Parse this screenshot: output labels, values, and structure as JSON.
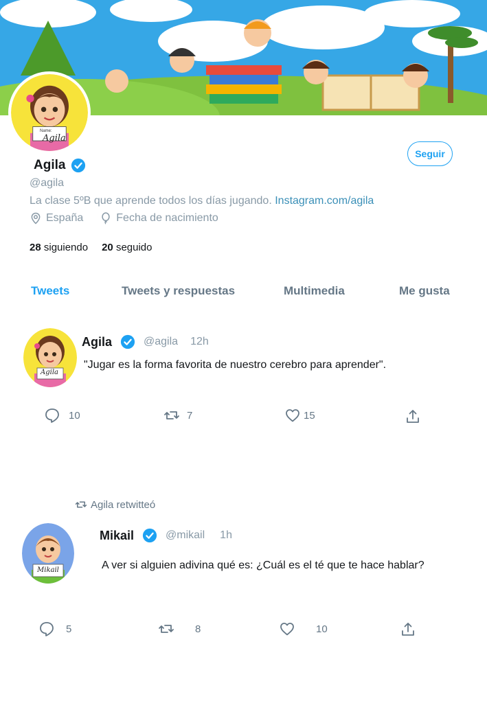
{
  "profile": {
    "name": "Agila",
    "handle": "@agila",
    "bio_text": "La clase 5ºB  que aprende todos los días jugando. ",
    "bio_link": "Instagram.com/agila",
    "location": "España",
    "birthday": "Fecha de nacimiento",
    "following_count": "28",
    "following_label": "siguiendo",
    "followers_count": "20",
    "followers_label": "seguido",
    "follow_button": "Seguir",
    "avatar_tag": "Agila",
    "avatar_name_prefix": "Name:"
  },
  "tabs": [
    {
      "label": "Tweets",
      "active": true
    },
    {
      "label": "Tweets y respuestas",
      "active": false
    },
    {
      "label": "Multimedia",
      "active": false
    },
    {
      "label": "Me gusta",
      "active": false
    }
  ],
  "tweets": [
    {
      "name": "Agila",
      "handle": "@agila",
      "time": "12h",
      "text": "\"Jugar es la forma favorita de nuestro cerebro para aprender\".",
      "avatar_tag": "Agila",
      "replies": "10",
      "retweets": "7",
      "likes": "15"
    },
    {
      "retweet_label": "Agila retwitteó",
      "name": "Mikail",
      "handle": "@mikail",
      "time": "1h",
      "text": "A ver si alguien adivina qué es: ¿Cuál es el té que te hace hablar?",
      "avatar_tag": "Mikail",
      "replies": "5",
      "retweets": "8",
      "likes": "10"
    }
  ],
  "colors": {
    "accent": "#1da1f2",
    "muted": "#8899a6",
    "link": "#3a8fb7"
  }
}
